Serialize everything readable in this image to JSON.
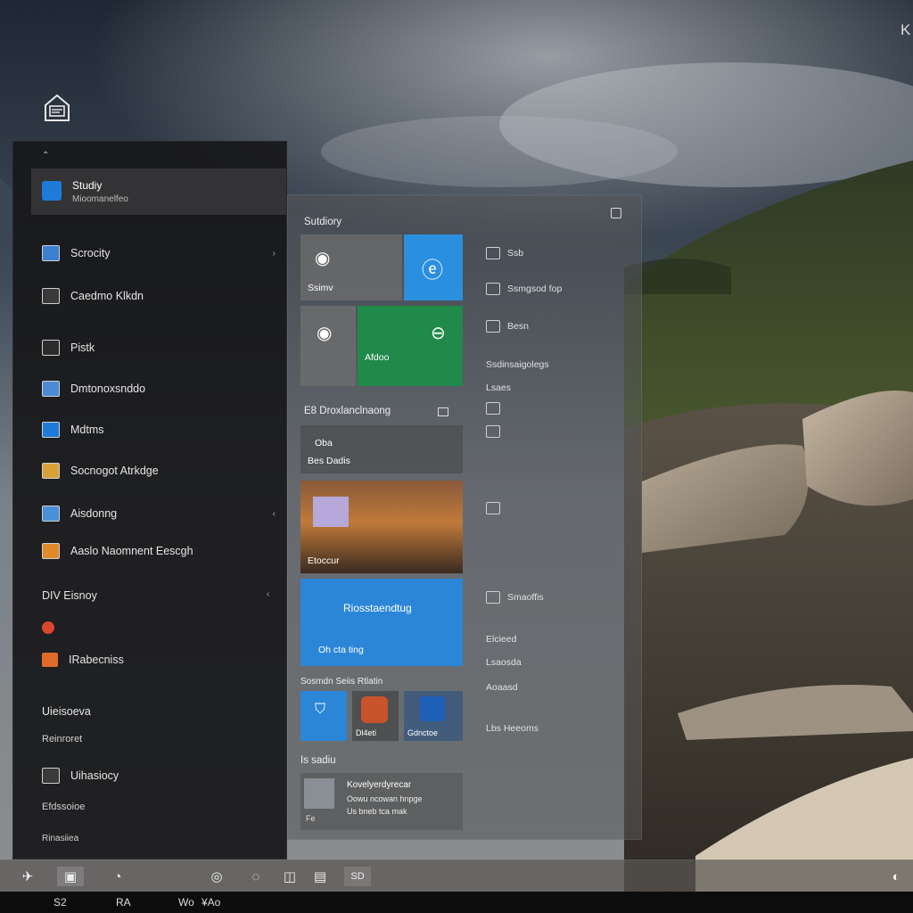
{
  "desktop": {
    "top_right_glyph": "K"
  },
  "start_menu": {
    "user": {
      "name": "Studiy",
      "subtitle": "Mioomanelfeo"
    },
    "items": [
      {
        "label": "Scrocity",
        "icon": "app-icon",
        "color": "#3b7fd1",
        "chevron": "›"
      },
      {
        "label": "Caedmo Klkdn",
        "icon": "app-icon",
        "color": "#3a3a3a"
      },
      {
        "label": "Pistk",
        "icon": "folder-icon",
        "color": "#2b2b2b"
      },
      {
        "label": "Dmtonoxsnddo",
        "icon": "photos-icon",
        "color": "#4b8bd6"
      },
      {
        "label": "Mdtms",
        "icon": "mail-icon",
        "color": "#1e7bd7"
      },
      {
        "label": "Socnogot Atrkdge",
        "icon": "store-icon",
        "color": "#d8a23a"
      },
      {
        "label": "Aisdonng",
        "icon": "app-icon",
        "color": "#4a90d8",
        "chevron": "‹"
      },
      {
        "label": "Aaslo Naomnent Eescgh",
        "icon": "edge-icon",
        "color": "#e08a2a"
      }
    ],
    "section1": {
      "label": "DIV Eisnoy",
      "chevron": "‹"
    },
    "section1_items": [
      {
        "label": "",
        "icon": "chrome-icon",
        "color": "#d9472f"
      },
      {
        "label": "IRabecniss",
        "icon": "app-icon",
        "color": "#e06a2a"
      }
    ],
    "section2": {
      "label": "Uieisoeva",
      "sub": "Reinroret"
    },
    "section3": {
      "label": "Uihasiocy",
      "sub": "Efdssoioe",
      "sub2": "Rinasiiea"
    }
  },
  "tiles": {
    "group1_title": "Sutdiory",
    "group2_title": "E8 Droxlanclnaong",
    "group3_title": "Sosmdn Seiis Rtlatin",
    "group4_title": "Is sadiu",
    "tile_a_label": "Ssimv",
    "tile_c_label": "",
    "tile_d_label": "Afdoo",
    "tile_e_label": "Oba",
    "tile_e_sub": "Bes Dadis",
    "tile_f_label": "Etoccur",
    "tile_g_label": "Riosstaendtug",
    "tile_g_sub": "Oh cta ting",
    "tile_h_label": "",
    "tile_i_label": "Dl4eti",
    "tile_j_label": "Gdnctoe",
    "news_title": "Kovelyerdyrecar",
    "news_line1": "Oowu ncowan hnpge",
    "news_line2": "Us bneb tca mak",
    "news_foot": "Fe",
    "right_col": [
      "Ssb",
      "Ssmgsod fop",
      "Besn",
      "Ssdinsaigolegs",
      "Lsaes",
      "",
      "",
      "",
      "Smaoffis",
      "Elcieed",
      "Lsaosda",
      "Aoaasd",
      "Lbs Heeoms"
    ]
  },
  "taskbar": {
    "icons": [
      "pin-icon",
      "explorer-icon",
      "store-icon",
      "edge-icon",
      "search-icon",
      "camera-icon",
      "photo-icon",
      "mail-icon"
    ],
    "badge": "SD"
  },
  "bottom_strip": {
    "items": [
      "S2",
      "RA",
      "Wo",
      "¥Ao"
    ]
  }
}
